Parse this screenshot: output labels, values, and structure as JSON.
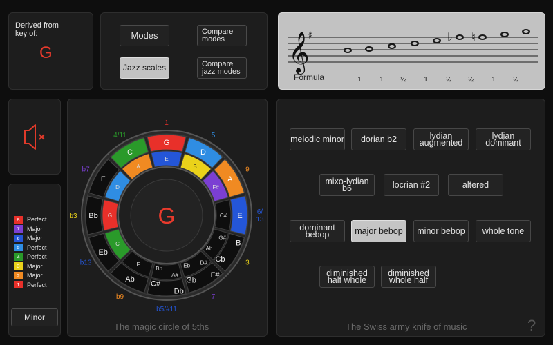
{
  "key_panel": {
    "label": "Derived from key of:",
    "key": "G"
  },
  "mode_buttons": {
    "modes": "Modes",
    "compare_modes": "Compare modes",
    "jazz_scales": "Jazz scales",
    "compare_jazz_modes": "Compare jazz modes"
  },
  "staff": {
    "formula_label": "Formula",
    "intervals": [
      "1",
      "1",
      "½",
      "1",
      "½",
      "½",
      "1",
      "½"
    ],
    "accidentals": [
      "♭",
      "♮"
    ],
    "key_signature": "♯",
    "clef": "𝄞"
  },
  "sound": {
    "icon": "speaker-muted-icon"
  },
  "legend": {
    "rows": [
      {
        "num": "8",
        "label": "Perfect",
        "color": "#e8302a"
      },
      {
        "num": "7",
        "label": "Major",
        "color": "#7b3fd3"
      },
      {
        "num": "6",
        "label": "Major",
        "color": "#2456d8"
      },
      {
        "num": "5",
        "label": "Perfect",
        "color": "#2f8de3"
      },
      {
        "num": "4",
        "label": "Perfect",
        "color": "#2a9a2a"
      },
      {
        "num": "3",
        "label": "Major",
        "color": "#ead21a"
      },
      {
        "num": "2",
        "label": "Major",
        "color": "#f08a22"
      },
      {
        "num": "1",
        "label": "Perfect",
        "color": "#e8302a"
      }
    ],
    "mode_button": "Minor"
  },
  "circle": {
    "center_key": "G",
    "caption": "The magic circle of 5ths",
    "outer_notes": [
      "G",
      "D",
      "A",
      "E",
      "B",
      "Cb",
      "F#",
      "Gb",
      "Db",
      "C#",
      "Ab",
      "Eb",
      "Bb",
      "F",
      "C"
    ],
    "inner_notes": [
      "E",
      "B",
      "F#",
      "C#",
      "G#",
      "Ab",
      "D#",
      "Eb",
      "A#",
      "Bb",
      "F",
      "C",
      "G",
      "D",
      "A"
    ],
    "degree_labels": [
      "1",
      "5",
      "9",
      "6/\n13",
      "3",
      "7",
      "b5/#11",
      "b9",
      "b13",
      "b3",
      "b7",
      "4/11"
    ],
    "colors": {
      "G": "#e8302a",
      "D": "#2f8de3",
      "C": "#2a9a2a",
      "A": "#f08a22",
      "E": "#2456d8",
      "B": "#ead21a",
      "F#": "#7b3fd3"
    }
  },
  "scales": {
    "caption": "The Swiss army knife of music",
    "help": "?",
    "buttons": [
      "melodic minor",
      "dorian b2",
      "lydian augmented",
      "lydian dominant",
      "mixo-lydian b6",
      "locrian #2",
      "altered",
      "dominant bebop",
      "major bebop",
      "minor bebop",
      "whole tone",
      "diminished half whole",
      "diminished whole half"
    ],
    "active": "major bebop"
  }
}
